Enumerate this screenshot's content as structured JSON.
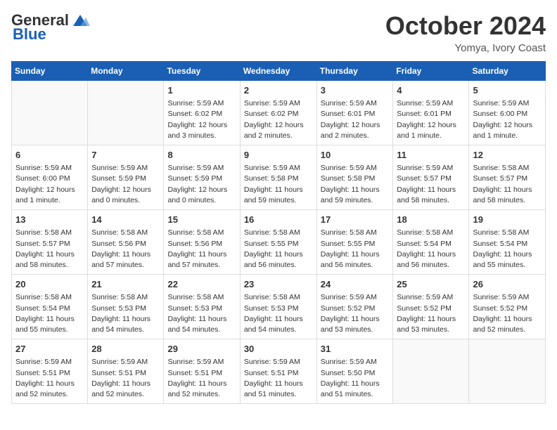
{
  "logo": {
    "line1": "General",
    "line2": "Blue"
  },
  "title": "October 2024",
  "location": "Yomya, Ivory Coast",
  "weekdays": [
    "Sunday",
    "Monday",
    "Tuesday",
    "Wednesday",
    "Thursday",
    "Friday",
    "Saturday"
  ],
  "weeks": [
    [
      {
        "day": "",
        "info": ""
      },
      {
        "day": "",
        "info": ""
      },
      {
        "day": "1",
        "info": "Sunrise: 5:59 AM\nSunset: 6:02 PM\nDaylight: 12 hours and 3 minutes."
      },
      {
        "day": "2",
        "info": "Sunrise: 5:59 AM\nSunset: 6:02 PM\nDaylight: 12 hours and 2 minutes."
      },
      {
        "day": "3",
        "info": "Sunrise: 5:59 AM\nSunset: 6:01 PM\nDaylight: 12 hours and 2 minutes."
      },
      {
        "day": "4",
        "info": "Sunrise: 5:59 AM\nSunset: 6:01 PM\nDaylight: 12 hours and 1 minute."
      },
      {
        "day": "5",
        "info": "Sunrise: 5:59 AM\nSunset: 6:00 PM\nDaylight: 12 hours and 1 minute."
      }
    ],
    [
      {
        "day": "6",
        "info": "Sunrise: 5:59 AM\nSunset: 6:00 PM\nDaylight: 12 hours and 1 minute."
      },
      {
        "day": "7",
        "info": "Sunrise: 5:59 AM\nSunset: 5:59 PM\nDaylight: 12 hours and 0 minutes."
      },
      {
        "day": "8",
        "info": "Sunrise: 5:59 AM\nSunset: 5:59 PM\nDaylight: 12 hours and 0 minutes."
      },
      {
        "day": "9",
        "info": "Sunrise: 5:59 AM\nSunset: 5:58 PM\nDaylight: 11 hours and 59 minutes."
      },
      {
        "day": "10",
        "info": "Sunrise: 5:59 AM\nSunset: 5:58 PM\nDaylight: 11 hours and 59 minutes."
      },
      {
        "day": "11",
        "info": "Sunrise: 5:59 AM\nSunset: 5:57 PM\nDaylight: 11 hours and 58 minutes."
      },
      {
        "day": "12",
        "info": "Sunrise: 5:58 AM\nSunset: 5:57 PM\nDaylight: 11 hours and 58 minutes."
      }
    ],
    [
      {
        "day": "13",
        "info": "Sunrise: 5:58 AM\nSunset: 5:57 PM\nDaylight: 11 hours and 58 minutes."
      },
      {
        "day": "14",
        "info": "Sunrise: 5:58 AM\nSunset: 5:56 PM\nDaylight: 11 hours and 57 minutes."
      },
      {
        "day": "15",
        "info": "Sunrise: 5:58 AM\nSunset: 5:56 PM\nDaylight: 11 hours and 57 minutes."
      },
      {
        "day": "16",
        "info": "Sunrise: 5:58 AM\nSunset: 5:55 PM\nDaylight: 11 hours and 56 minutes."
      },
      {
        "day": "17",
        "info": "Sunrise: 5:58 AM\nSunset: 5:55 PM\nDaylight: 11 hours and 56 minutes."
      },
      {
        "day": "18",
        "info": "Sunrise: 5:58 AM\nSunset: 5:54 PM\nDaylight: 11 hours and 56 minutes."
      },
      {
        "day": "19",
        "info": "Sunrise: 5:58 AM\nSunset: 5:54 PM\nDaylight: 11 hours and 55 minutes."
      }
    ],
    [
      {
        "day": "20",
        "info": "Sunrise: 5:58 AM\nSunset: 5:54 PM\nDaylight: 11 hours and 55 minutes."
      },
      {
        "day": "21",
        "info": "Sunrise: 5:58 AM\nSunset: 5:53 PM\nDaylight: 11 hours and 54 minutes."
      },
      {
        "day": "22",
        "info": "Sunrise: 5:58 AM\nSunset: 5:53 PM\nDaylight: 11 hours and 54 minutes."
      },
      {
        "day": "23",
        "info": "Sunrise: 5:58 AM\nSunset: 5:53 PM\nDaylight: 11 hours and 54 minutes."
      },
      {
        "day": "24",
        "info": "Sunrise: 5:59 AM\nSunset: 5:52 PM\nDaylight: 11 hours and 53 minutes."
      },
      {
        "day": "25",
        "info": "Sunrise: 5:59 AM\nSunset: 5:52 PM\nDaylight: 11 hours and 53 minutes."
      },
      {
        "day": "26",
        "info": "Sunrise: 5:59 AM\nSunset: 5:52 PM\nDaylight: 11 hours and 52 minutes."
      }
    ],
    [
      {
        "day": "27",
        "info": "Sunrise: 5:59 AM\nSunset: 5:51 PM\nDaylight: 11 hours and 52 minutes."
      },
      {
        "day": "28",
        "info": "Sunrise: 5:59 AM\nSunset: 5:51 PM\nDaylight: 11 hours and 52 minutes."
      },
      {
        "day": "29",
        "info": "Sunrise: 5:59 AM\nSunset: 5:51 PM\nDaylight: 11 hours and 52 minutes."
      },
      {
        "day": "30",
        "info": "Sunrise: 5:59 AM\nSunset: 5:51 PM\nDaylight: 11 hours and 51 minutes."
      },
      {
        "day": "31",
        "info": "Sunrise: 5:59 AM\nSunset: 5:50 PM\nDaylight: 11 hours and 51 minutes."
      },
      {
        "day": "",
        "info": ""
      },
      {
        "day": "",
        "info": ""
      }
    ]
  ]
}
